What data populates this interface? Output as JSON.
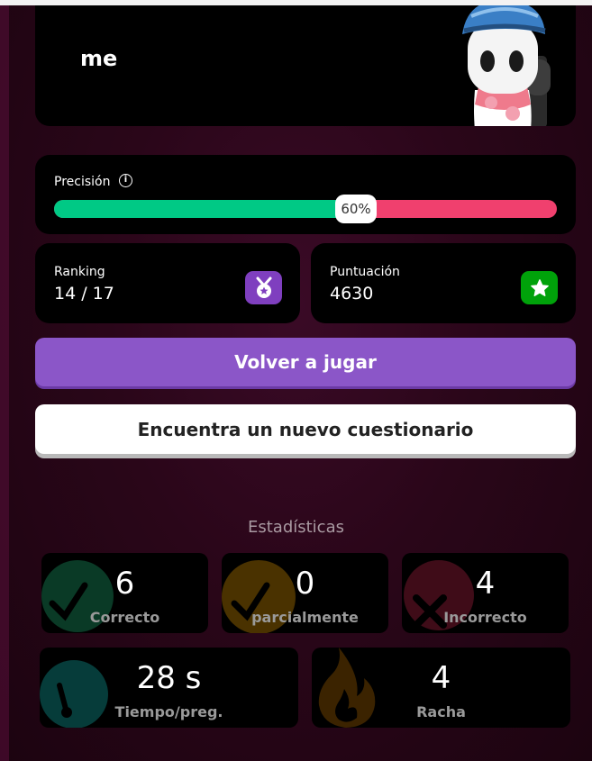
{
  "player": {
    "name": "me"
  },
  "accuracy": {
    "label": "Precisión",
    "percent_text": "60%",
    "percent": 60
  },
  "ranking": {
    "label": "Ranking",
    "value": "14 / 17"
  },
  "score": {
    "label": "Puntuación",
    "value": "4630"
  },
  "buttons": {
    "play_again": "Volver a jugar",
    "find_quiz": "Encuentra un nuevo cuestionario"
  },
  "stats": {
    "title": "Estadísticas",
    "correct": {
      "value": "6",
      "label": "Correcto"
    },
    "partial": {
      "value": "0",
      "label": "parcialmente"
    },
    "incorrect": {
      "value": "4",
      "label": "Incorrecto"
    },
    "time": {
      "value": "28 s",
      "label": "Tiempo/preg."
    },
    "streak": {
      "value": "4",
      "label": "Racha"
    }
  },
  "colors": {
    "correct": "#00c985",
    "incorrect": "#f0406e",
    "primary": "#8b56c8",
    "ranking_badge": "#7f3fbf",
    "score_badge": "#00a20a"
  },
  "icons": [
    "info-icon",
    "medal-icon",
    "star-icon",
    "check-icon",
    "cross-icon",
    "stopwatch-icon",
    "flame-icon"
  ]
}
